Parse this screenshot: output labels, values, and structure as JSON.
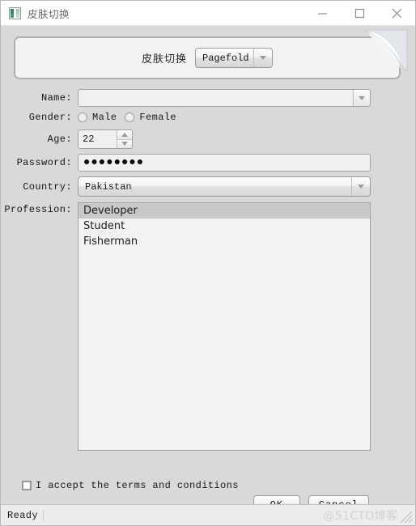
{
  "window": {
    "title": "皮肤切换",
    "icon": "app-window-icon",
    "controls": {
      "minimize": "minimize-icon",
      "maximize": "maximize-icon",
      "close": "close-icon"
    }
  },
  "skin_panel": {
    "label": "皮肤切换",
    "selected_skin": "Pagefold",
    "decoration": "page-fold-corner"
  },
  "form": {
    "name": {
      "label": "Name:",
      "value": "",
      "placeholder": ""
    },
    "gender": {
      "label": "Gender:",
      "male_label": "Male",
      "female_label": "Female",
      "selected": ""
    },
    "age": {
      "label": "Age:",
      "value": "22"
    },
    "password": {
      "label": "Password:",
      "masked_value": "●●●●●●●●"
    },
    "country": {
      "label": "Country:",
      "value": "Pakistan"
    },
    "profession": {
      "label": "Profession:",
      "items": [
        "Developer",
        "Student",
        "Fisherman"
      ],
      "selected_index": 0
    },
    "accept": {
      "label": "I accept the terms and conditions",
      "checked": false
    }
  },
  "buttons": {
    "ok": "OK",
    "cancel": "Cancel"
  },
  "statusbar": {
    "status": "Ready",
    "watermark": "@51CTO博客"
  },
  "colors": {
    "window_bg": "#d9d9d9",
    "panel_bg": "#f2f2f2",
    "panel_border": "#b0b0b0",
    "field_bg": "#f0f0f0",
    "selection": "#c8c8c8",
    "titlebar_bg": "#ffffff",
    "statusbar_bg": "#ededed",
    "watermark": "#d2d2d2"
  }
}
